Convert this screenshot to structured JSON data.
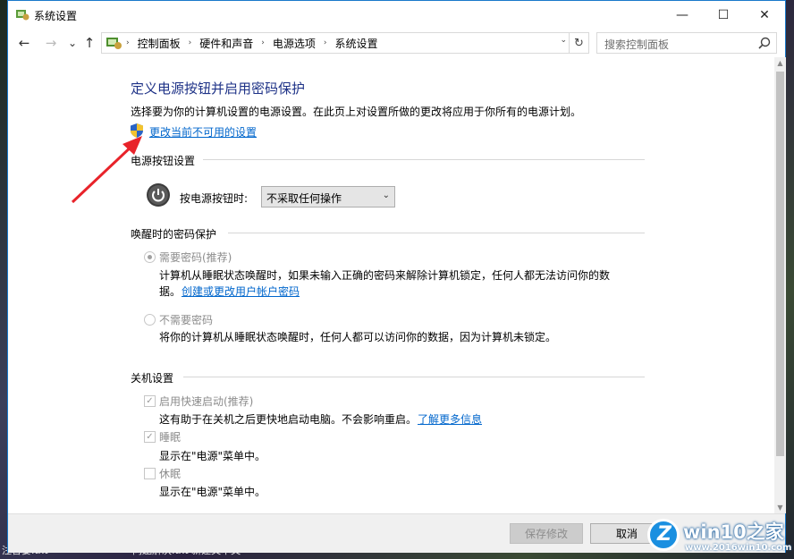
{
  "window": {
    "title": "系统设置",
    "controls": {
      "minimize": "—",
      "maximize": "☐",
      "close": "✕"
    }
  },
  "nav": {
    "back": "←",
    "forward": "→",
    "down": "⌄",
    "up": "↑",
    "breadcrumb": [
      "控制面板",
      "硬件和声音",
      "电源选项",
      "系统设置"
    ],
    "breadcrumb_sep": "›",
    "refresh": "↻",
    "search_placeholder": "搜索控制面板"
  },
  "page": {
    "heading": "定义电源按钮并启用密码保护",
    "description": "选择要为你的计算机设置的电源设置。在此页上对设置所做的更改将应用于你所有的电源计划。",
    "change_link": "更改当前不可用的设置"
  },
  "power_buttons": {
    "section_title": "电源按钮设置",
    "label": "按电源按钮时:",
    "selected": "不采取任何操作"
  },
  "password": {
    "section_title": "唤醒时的密码保护",
    "require_label": "需要密码(推荐)",
    "require_desc_1": "计算机从睡眠状态唤醒时，如果未输入正确的密码来解除计算机锁定，任何人都无法访问你的数",
    "require_desc_2": "据。",
    "account_link": "创建或更改用户帐户密码",
    "no_require_label": "不需要密码",
    "no_require_desc": "将你的计算机从睡眠状态唤醒时，任何人都可以访问你的数据，因为计算机未锁定。"
  },
  "shutdown": {
    "section_title": "关机设置",
    "fast_startup_label": "启用快速启动(推荐)",
    "fast_startup_desc": "这有助于在关机之后更快地启动电脑。不会影响重启。",
    "learn_more": "了解更多信息",
    "sleep_label": "睡眠",
    "sleep_desc": "显示在\"电源\"菜单中。",
    "hibernate_label": "休眠",
    "hibernate_desc": "显示在\"电源\"菜单中。"
  },
  "footer": {
    "save": "保存修改",
    "cancel": "取消"
  },
  "watermark": {
    "logo_letter": "Z",
    "title": "win10之家",
    "url": "www.2016win10.com"
  },
  "desktop": {
    "taskbar_text_1": "注音宴.txt",
    "taskbar_text_2": "问题解决.txt    新建文本文"
  },
  "colors": {
    "heading": "#1e3287",
    "link": "#0066cc",
    "window_border": "#1979ca",
    "annotation_arrow": "#e8232a"
  }
}
